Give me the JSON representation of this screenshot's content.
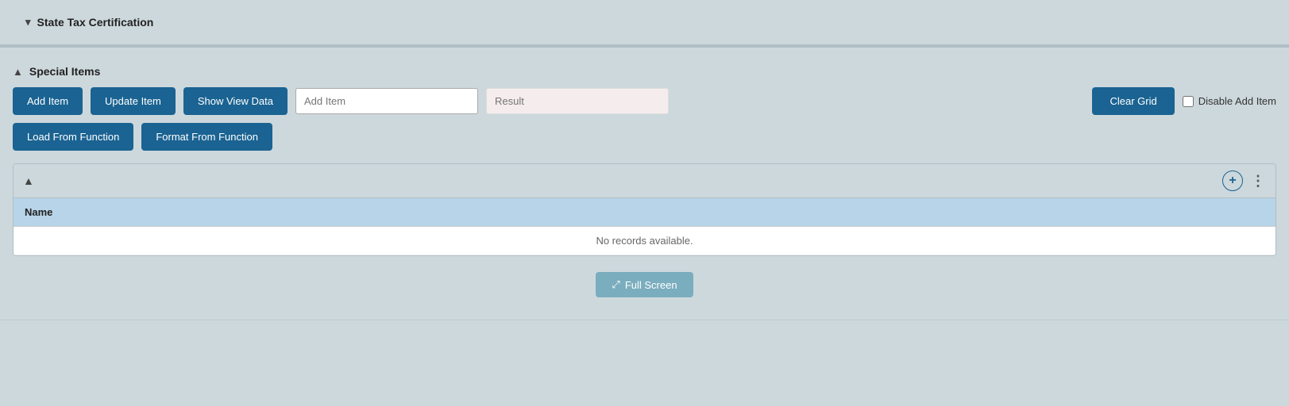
{
  "stateTaxSection": {
    "chevron": "▾",
    "title": "State Tax Certification",
    "collapsed": true
  },
  "specialItemsSection": {
    "chevron": "▲",
    "title": "Special Items",
    "collapsed": false
  },
  "toolbar": {
    "addItemBtn": "Add Item",
    "updateItemBtn": "Update Item",
    "showViewDataBtn": "Show View Data",
    "addItemPlaceholder": "Add Item",
    "resultPlaceholder": "Result",
    "clearGridBtn": "Clear Grid",
    "disableAddItemLabel": "Disable Add Item",
    "loadFromFunctionBtn": "Load From Function",
    "formatFromFunctionBtn": "Format From Function"
  },
  "grid": {
    "columnName": "Name",
    "noRecordsText": "No records available.",
    "addIcon": "+",
    "kebabIcon": "⋮",
    "chevronUp": "▲"
  },
  "fullscreen": {
    "icon": "⤢",
    "label": "Full Screen"
  }
}
